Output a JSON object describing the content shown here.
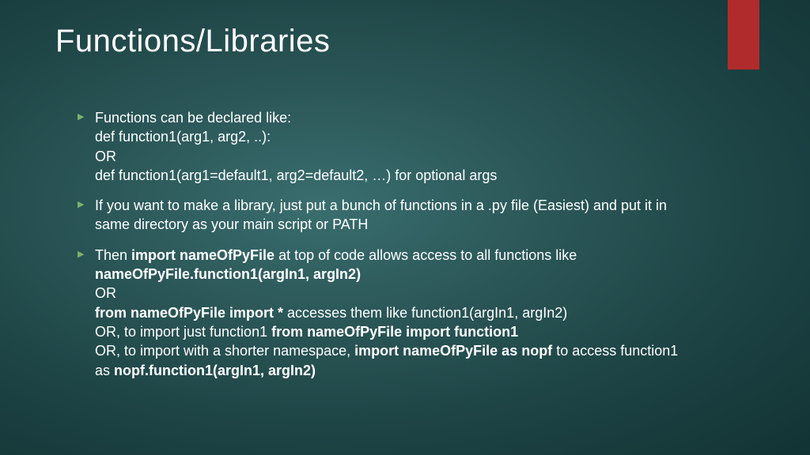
{
  "title": "Functions/Libraries",
  "bullets": [
    {
      "lines": [
        {
          "text": "Functions can be declared like:"
        },
        {
          "text": "def function1(arg1, arg2, ..):"
        },
        {
          "text": "OR"
        },
        {
          "text": "def function1(arg1=default1, arg2=default2, …) for optional args"
        }
      ]
    },
    {
      "lines": [
        {
          "text": "If you want to make a library, just put a bunch of functions in a .py file (Easiest) and put it in same directory as your main script or PATH"
        }
      ]
    },
    {
      "lines": [
        {
          "parts": [
            {
              "t": "Then "
            },
            {
              "t": "import nameOfPyFile",
              "b": true
            },
            {
              "t": " at top of code allows access to all functions like "
            },
            {
              "t": "nameOfPyFile.function1(argIn1, argIn2)",
              "b": true
            }
          ]
        },
        {
          "text": "OR"
        },
        {
          "parts": [
            {
              "t": "from nameOfPyFile import *",
              "b": true
            },
            {
              "t": " accesses them like function1(argIn1, argIn2)"
            }
          ]
        },
        {
          "parts": [
            {
              "t": "OR, to import just function1 "
            },
            {
              "t": "from nameOfPyFile import function1",
              "b": true
            }
          ]
        },
        {
          "parts": [
            {
              "t": "OR, to import with a shorter namespace, "
            },
            {
              "t": "import nameOfPyFile as nopf",
              "b": true
            },
            {
              "t": " to access function1 as "
            },
            {
              "t": "nopf.function1(argIn1, argIn2)",
              "b": true
            }
          ]
        }
      ]
    }
  ]
}
